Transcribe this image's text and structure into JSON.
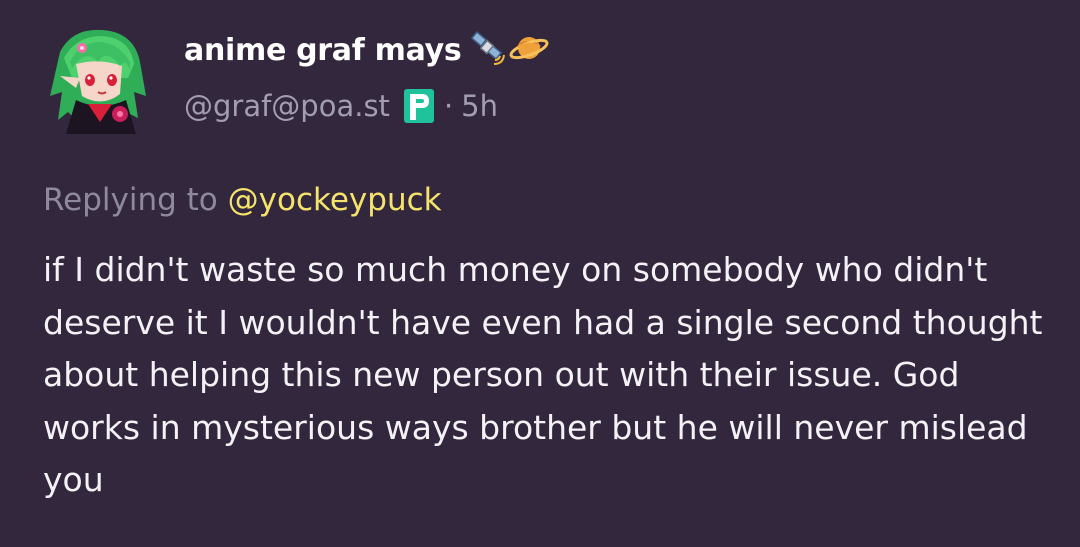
{
  "post": {
    "author": {
      "display_name": "anime graf mays",
      "display_name_emojis": [
        "satellite-icon",
        "ringed-planet-icon"
      ],
      "handle": "@graf@poa.st",
      "instance_badge_icon": "pleroma-p-icon",
      "avatar_icon": "green-haired-anime-girl-avatar"
    },
    "separator": "·",
    "timestamp": "5h",
    "reply": {
      "prefix": "Replying to",
      "mention": "@yockeypuck"
    },
    "body": "if I didn't waste so much money on somebody who didn't deserve it I wouldn't have even had a single second thought about helping this new person out with their issue. God works in mysterious ways brother but he will never mislead you"
  },
  "colors": {
    "background": "#32273c",
    "text": "#f4f2f6",
    "muted": "#a39db0",
    "mention": "#f5e36b",
    "badge_green": "#1fc29b"
  }
}
